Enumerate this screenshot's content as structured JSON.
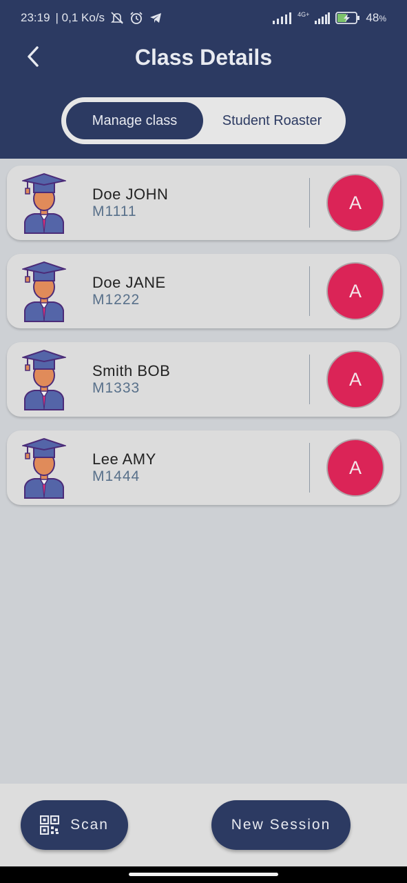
{
  "status_bar": {
    "time": "23:19",
    "speed": "| 0,1 Ko/s",
    "network": "4G+",
    "battery": "48",
    "battery_unit": "%",
    "icons": [
      "bell-off-icon",
      "alarm-icon",
      "telegram-icon",
      "signal-icon",
      "battery-charging-icon"
    ]
  },
  "header": {
    "title": "Class Details",
    "back_icon": "chevron-left-icon"
  },
  "tabs": [
    {
      "label": "Manage class",
      "active": true
    },
    {
      "label": "Student Roaster",
      "active": false
    }
  ],
  "students": [
    {
      "name": "Doe JOHN",
      "id": "M1111",
      "status": "A"
    },
    {
      "name": "Doe JANE",
      "id": "M1222",
      "status": "A"
    },
    {
      "name": "Smith BOB",
      "id": "M1333",
      "status": "A"
    },
    {
      "name": "Lee AMY",
      "id": "M1444",
      "status": "A"
    }
  ],
  "actions": {
    "scan_label": "Scan",
    "scan_icon": "qr-code-icon",
    "new_session_label": "New Session"
  },
  "colors": {
    "primary": "#2c3a62",
    "absent": "#db2457",
    "background": "#cdd0d4"
  }
}
